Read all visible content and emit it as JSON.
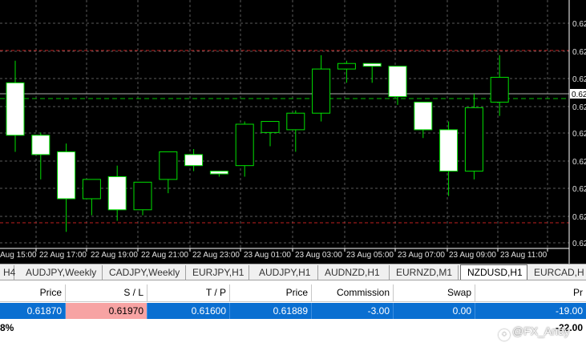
{
  "chart": {
    "symbol": "NZDUSD",
    "timeframe": "H1",
    "colors": {
      "background": "#000000",
      "grid": "#5a5a5a",
      "bull_body": "#000000",
      "bear_body": "#ffffff",
      "candle_outline": "#00e000",
      "sl_line": "#c02020",
      "tp_line": "#c02020",
      "entry_line": "#00c000",
      "axis_text": "#e0e0e0"
    },
    "price_axis_labels": [
      "0.62",
      "0.62",
      "0.62",
      "0.62",
      "0.62",
      "0.62",
      "0.62",
      "0.62",
      "0.62"
    ],
    "current_price_tag": "0.62",
    "time_axis_labels": [
      "Aug 15:00",
      "22 Aug 17:00",
      "22 Aug 19:00",
      "22 Aug 21:00",
      "22 Aug 23:00",
      "23 Aug 01:00",
      "23 Aug 03:00",
      "23 Aug 05:00",
      "23 Aug 07:00",
      "23 Aug 09:00",
      "23 Aug 11:00"
    ]
  },
  "chart_data": {
    "type": "candlestick",
    "ohlc": [
      {
        "o": 0.621,
        "h": 0.6218,
        "l": 0.6185,
        "c": 0.6191
      },
      {
        "o": 0.6191,
        "h": 0.6192,
        "l": 0.6175,
        "c": 0.6184
      },
      {
        "o": 0.6185,
        "h": 0.6188,
        "l": 0.6156,
        "c": 0.6168
      },
      {
        "o": 0.6168,
        "h": 0.6175,
        "l": 0.6162,
        "c": 0.6175
      },
      {
        "o": 0.6176,
        "h": 0.618,
        "l": 0.616,
        "c": 0.6164
      },
      {
        "o": 0.6164,
        "h": 0.6174,
        "l": 0.6162,
        "c": 0.6174
      },
      {
        "o": 0.6175,
        "h": 0.6185,
        "l": 0.617,
        "c": 0.6185
      },
      {
        "o": 0.6184,
        "h": 0.6186,
        "l": 0.6178,
        "c": 0.618
      },
      {
        "o": 0.6178,
        "h": 0.6178,
        "l": 0.6176,
        "c": 0.6177
      },
      {
        "o": 0.618,
        "h": 0.6196,
        "l": 0.6176,
        "c": 0.6195
      },
      {
        "o": 0.6192,
        "h": 0.6196,
        "l": 0.6187,
        "c": 0.6196
      },
      {
        "o": 0.6193,
        "h": 0.62,
        "l": 0.6185,
        "c": 0.6199
      },
      {
        "o": 0.6199,
        "h": 0.622,
        "l": 0.6196,
        "c": 0.6215
      },
      {
        "o": 0.6215,
        "h": 0.6218,
        "l": 0.621,
        "c": 0.6217
      },
      {
        "o": 0.6217,
        "h": 0.6217,
        "l": 0.621,
        "c": 0.6216
      },
      {
        "o": 0.6216,
        "h": 0.6216,
        "l": 0.6202,
        "c": 0.6205
      },
      {
        "o": 0.6203,
        "h": 0.6203,
        "l": 0.619,
        "c": 0.6193
      },
      {
        "o": 0.6193,
        "h": 0.6196,
        "l": 0.6169,
        "c": 0.6178
      },
      {
        "o": 0.6178,
        "h": 0.6206,
        "l": 0.6175,
        "c": 0.6201
      },
      {
        "o": 0.6203,
        "h": 0.622,
        "l": 0.6198,
        "c": 0.6212
      }
    ],
    "price_range": [
      0.615,
      0.624
    ],
    "lines": {
      "sl": 0.6197,
      "tp": 0.616,
      "entry": 0.6189
    },
    "grid": true
  },
  "tabs": [
    {
      "label": "H4",
      "active": false
    },
    {
      "label": "AUDJPY,Weekly",
      "active": false
    },
    {
      "label": "CADJPY,Weekly",
      "active": false
    },
    {
      "label": "EURJPY,H1",
      "active": false
    },
    {
      "label": "AUDJPY,H1",
      "active": false
    },
    {
      "label": "AUDNZD,H1",
      "active": false
    },
    {
      "label": "EURNZD,M1",
      "active": false
    },
    {
      "label": "NZDUSD,H1",
      "active": true
    },
    {
      "label": "EURCAD,H",
      "active": false
    }
  ],
  "orders": {
    "headers": [
      "Price",
      "S / L",
      "T / P",
      "Price",
      "Commission",
      "Swap",
      "Pr"
    ],
    "row": [
      "0.61870",
      "0.61970",
      "0.61600",
      "0.61889",
      "-3.00",
      "0.00",
      "-19.00"
    ],
    "balance_left": "8%",
    "balance_right": "-22.00"
  },
  "watermark": {
    "text": "@FX_Andy"
  }
}
